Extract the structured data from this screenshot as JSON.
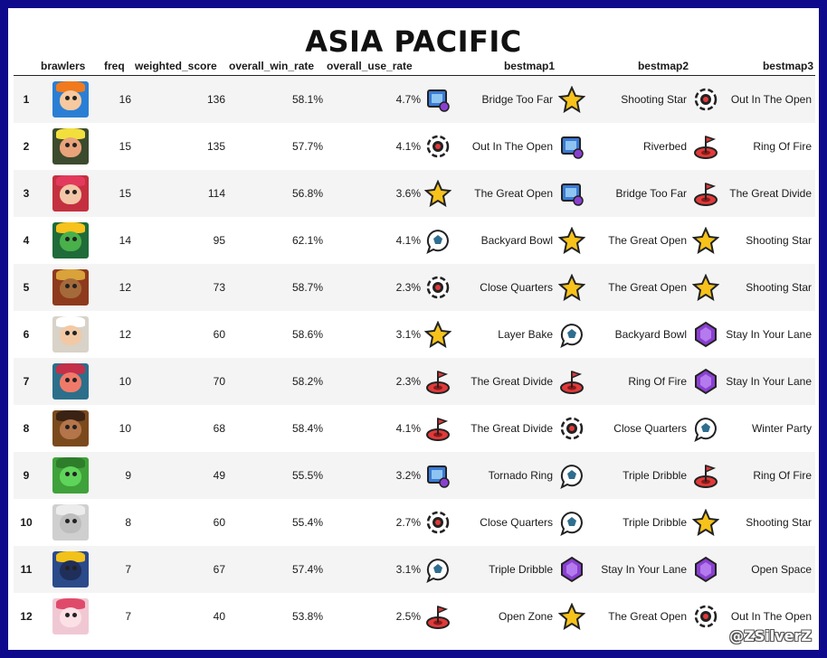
{
  "title": "ASIA PACIFIC",
  "columns": [
    "",
    "brawlers",
    "freq",
    "weighted_score",
    "overall_win_rate",
    "overall_use_rate",
    "bestmap1",
    "bestmap2",
    "bestmap3"
  ],
  "mode_icons": {
    "heist": {
      "icon": "safe-icon",
      "color": "#3a7bd5"
    },
    "bounty": {
      "icon": "star-icon",
      "color": "#f7c21b"
    },
    "hotzone": {
      "icon": "target-icon",
      "color": "#e03a3a"
    },
    "knockout": {
      "icon": "skull-target-icon",
      "color": "#222222"
    },
    "brawlball": {
      "icon": "ball-icon",
      "color": "#2f6e8f"
    },
    "gemgrab": {
      "icon": "gem-icon",
      "color": "#8a3fd1"
    }
  },
  "rows": [
    {
      "rank": "1",
      "freq": "16",
      "weighted_score": "136",
      "win_rate": "58.1%",
      "use_rate": "4.7%",
      "maps": [
        {
          "name": "Bridge Too Far",
          "mode": "heist"
        },
        {
          "name": "Shooting Star",
          "mode": "bounty"
        },
        {
          "name": "Out In The Open",
          "mode": "knockout"
        }
      ],
      "avatar": {
        "bg": "#2a7fd4",
        "hair": "#f07a1d",
        "face": "#f6c9a0",
        "icon": "brawler-portrait-icon"
      }
    },
    {
      "rank": "2",
      "freq": "15",
      "weighted_score": "135",
      "win_rate": "57.7%",
      "use_rate": "4.1%",
      "maps": [
        {
          "name": "Out In The Open",
          "mode": "knockout"
        },
        {
          "name": "Riverbed",
          "mode": "heist"
        },
        {
          "name": "Ring Of Fire",
          "mode": "hotzone"
        }
      ],
      "avatar": {
        "bg": "#3c4a2e",
        "hair": "#f2df3c",
        "face": "#e9a37b",
        "icon": "brawler-portrait-icon"
      }
    },
    {
      "rank": "3",
      "freq": "15",
      "weighted_score": "114",
      "win_rate": "56.8%",
      "use_rate": "3.6%",
      "maps": [
        {
          "name": "The Great Open",
          "mode": "bounty"
        },
        {
          "name": "Bridge Too Far",
          "mode": "heist"
        },
        {
          "name": "The Great Divide",
          "mode": "hotzone"
        }
      ],
      "avatar": {
        "bg": "#c43040",
        "hair": "#e23a5c",
        "face": "#f4c6a8",
        "icon": "brawler-portrait-icon"
      }
    },
    {
      "rank": "4",
      "freq": "14",
      "weighted_score": "95",
      "win_rate": "62.1%",
      "use_rate": "4.1%",
      "maps": [
        {
          "name": "Backyard Bowl",
          "mode": "brawlball"
        },
        {
          "name": "The Great Open",
          "mode": "bounty"
        },
        {
          "name": "Shooting Star",
          "mode": "bounty"
        }
      ],
      "avatar": {
        "bg": "#1f6b3a",
        "hair": "#f7c21b",
        "face": "#49b04a",
        "icon": "brawler-portrait-icon"
      }
    },
    {
      "rank": "5",
      "freq": "12",
      "weighted_score": "73",
      "win_rate": "58.7%",
      "use_rate": "2.3%",
      "maps": [
        {
          "name": "Close Quarters",
          "mode": "knockout"
        },
        {
          "name": "The Great Open",
          "mode": "bounty"
        },
        {
          "name": "Shooting Star",
          "mode": "bounty"
        }
      ],
      "avatar": {
        "bg": "#8e3a1d",
        "hair": "#d9a23a",
        "face": "#a56a3a",
        "icon": "brawler-portrait-icon"
      }
    },
    {
      "rank": "6",
      "freq": "12",
      "weighted_score": "60",
      "win_rate": "58.6%",
      "use_rate": "3.1%",
      "maps": [
        {
          "name": "Layer Bake",
          "mode": "bounty"
        },
        {
          "name": "Backyard Bowl",
          "mode": "brawlball"
        },
        {
          "name": "Stay In Your Lane",
          "mode": "gemgrab"
        }
      ],
      "avatar": {
        "bg": "#d8d2c8",
        "hair": "#ffffff",
        "face": "#f2c9a4",
        "icon": "brawler-portrait-icon"
      }
    },
    {
      "rank": "7",
      "freq": "10",
      "weighted_score": "70",
      "win_rate": "58.2%",
      "use_rate": "2.3%",
      "maps": [
        {
          "name": "The Great Divide",
          "mode": "hotzone"
        },
        {
          "name": "Ring Of Fire",
          "mode": "hotzone"
        },
        {
          "name": "Stay In Your Lane",
          "mode": "gemgrab"
        }
      ],
      "avatar": {
        "bg": "#2c6f8a",
        "hair": "#c2304a",
        "face": "#f07a6a",
        "icon": "brawler-portrait-icon"
      }
    },
    {
      "rank": "8",
      "freq": "10",
      "weighted_score": "68",
      "win_rate": "58.4%",
      "use_rate": "4.1%",
      "maps": [
        {
          "name": "The Great Divide",
          "mode": "hotzone"
        },
        {
          "name": "Close Quarters",
          "mode": "knockout"
        },
        {
          "name": "Winter Party",
          "mode": "brawlball"
        }
      ],
      "avatar": {
        "bg": "#7a4a1d",
        "hair": "#3a2214",
        "face": "#b4754a",
        "icon": "brawler-portrait-icon"
      }
    },
    {
      "rank": "9",
      "freq": "9",
      "weighted_score": "49",
      "win_rate": "55.5%",
      "use_rate": "3.2%",
      "maps": [
        {
          "name": "Tornado Ring",
          "mode": "heist"
        },
        {
          "name": "Triple Dribble",
          "mode": "brawlball"
        },
        {
          "name": "Ring Of Fire",
          "mode": "hotzone"
        }
      ],
      "avatar": {
        "bg": "#3fa13a",
        "hair": "#2e7d2a",
        "face": "#5fd45a",
        "icon": "brawler-portrait-icon"
      }
    },
    {
      "rank": "10",
      "freq": "8",
      "weighted_score": "60",
      "win_rate": "55.4%",
      "use_rate": "2.7%",
      "maps": [
        {
          "name": "Close Quarters",
          "mode": "knockout"
        },
        {
          "name": "Triple Dribble",
          "mode": "brawlball"
        },
        {
          "name": "Shooting Star",
          "mode": "bounty"
        }
      ],
      "avatar": {
        "bg": "#cfcfcf",
        "hair": "#ececec",
        "face": "#bdbdbd",
        "icon": "brawler-portrait-icon"
      }
    },
    {
      "rank": "11",
      "freq": "7",
      "weighted_score": "67",
      "win_rate": "57.4%",
      "use_rate": "3.1%",
      "maps": [
        {
          "name": "Triple Dribble",
          "mode": "brawlball"
        },
        {
          "name": "Stay In Your Lane",
          "mode": "gemgrab"
        },
        {
          "name": "Open Space",
          "mode": "gemgrab"
        }
      ],
      "avatar": {
        "bg": "#2a4a8a",
        "hair": "#f2c21b",
        "face": "#1f2f5a",
        "icon": "brawler-portrait-icon"
      }
    },
    {
      "rank": "12",
      "freq": "7",
      "weighted_score": "40",
      "win_rate": "53.8%",
      "use_rate": "2.5%",
      "maps": [
        {
          "name": "Open Zone",
          "mode": "hotzone"
        },
        {
          "name": "The Great Open",
          "mode": "bounty"
        },
        {
          "name": "Out In The Open",
          "mode": "knockout"
        }
      ],
      "avatar": {
        "bg": "#f0c8d4",
        "hair": "#e04a6a",
        "face": "#fbe0e6",
        "icon": "brawler-portrait-icon"
      }
    }
  ],
  "watermark": "@ZSilverZ"
}
